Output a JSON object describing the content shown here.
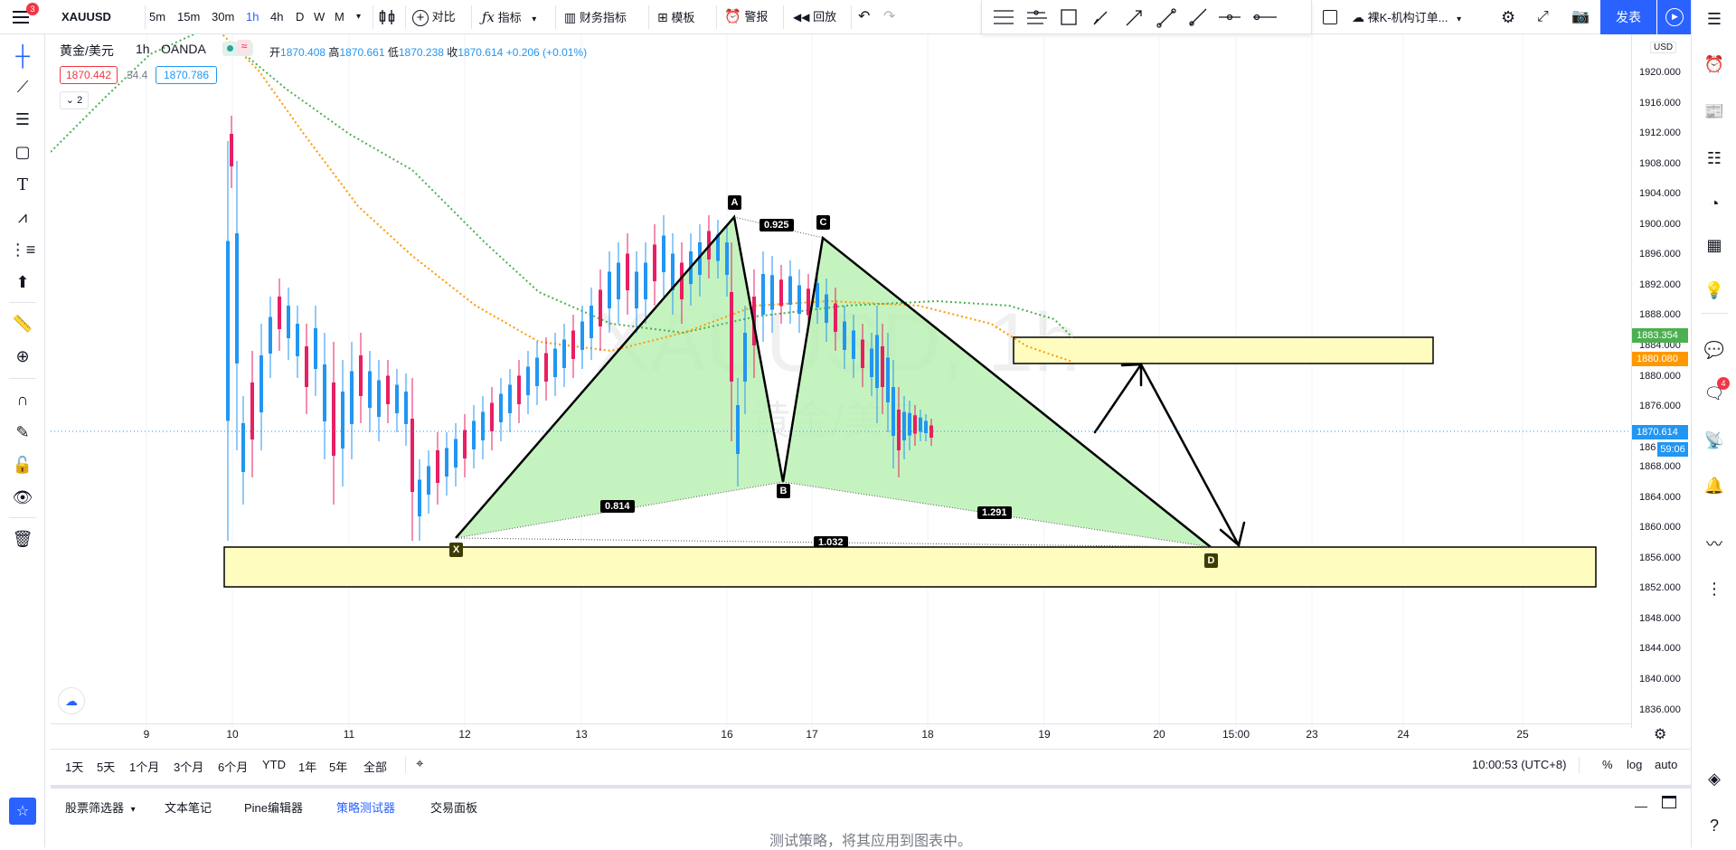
{
  "toolbar": {
    "symbol": "XAUUSD",
    "intervals": [
      "5m",
      "15m",
      "30m",
      "1h",
      "4h",
      "D",
      "W",
      "M"
    ],
    "compare": "对比",
    "indicators": "指标",
    "financials": "财务指标",
    "templates": "模板",
    "alerts": "警报",
    "replay": "回放",
    "layout_name": "裸K-机构订单...",
    "publish": "发表",
    "menu_badge": "3"
  },
  "legend": {
    "title": "黄金/美元",
    "interval": "1h",
    "source": "OANDA",
    "open_label": "开",
    "open": "1870.408",
    "high_label": "高",
    "high": "1870.661",
    "low_label": "低",
    "low": "1870.238",
    "close_label": "收",
    "close": "1870.614",
    "change": "+0.206 (+0.01%)",
    "bid": "1870.442",
    "spread": "34.4",
    "ask": "1870.786",
    "collapsed_count": "2"
  },
  "watermark": {
    "symbol": "XAUUSD, 1h",
    "name": "黄金/美元"
  },
  "price_axis": {
    "currency": "USD",
    "ticks": [
      "1920.000",
      "1916.000",
      "1912.000",
      "1908.000",
      "1904.000",
      "1900.000",
      "1896.000",
      "1892.000",
      "1888.000",
      "1884.000",
      "1880.000",
      "1876.000",
      "1872.000",
      "1868.000",
      "1864.000",
      "1860.000",
      "1856.000",
      "1852.000",
      "1848.000",
      "1844.000",
      "1840.000",
      "1836.000"
    ],
    "tag_green": "1883.354",
    "tag_orange": "1880.080",
    "tag_last": "1870.614",
    "tag_countdown": "59:06",
    "tag_last_partial": "186"
  },
  "time_axis": {
    "ticks": [
      "9",
      "10",
      "11",
      "12",
      "13",
      "16",
      "17",
      "18",
      "19",
      "20",
      "15:00",
      "23",
      "24",
      "25"
    ]
  },
  "pattern": {
    "points": [
      "X",
      "A",
      "B",
      "C",
      "D"
    ],
    "ratios": [
      "0.925",
      "0.814",
      "1.291",
      "1.032"
    ]
  },
  "ranges": [
    "1天",
    "5天",
    "1个月",
    "3个月",
    "6个月",
    "YTD",
    "1年",
    "5年",
    "全部"
  ],
  "clock": "10:00:53 (UTC+8)",
  "scale_options": [
    "%",
    "log",
    "auto"
  ],
  "bottom_tabs": [
    "股票筛选器",
    "文本笔记",
    "Pine编辑器",
    "策略测试器",
    "交易面板"
  ],
  "active_tab": "策略测试器",
  "strategy_hint": "测试策略，将其应用到图表中。",
  "notification_badge": "4",
  "colors": {
    "bull": "#2196f3",
    "bear": "#e91e63",
    "pattern_fill": "#b7f0b0",
    "zone_fill": "#fffcc0",
    "ma_green": "#4caf50",
    "ma_orange": "#ff9800",
    "accent": "#2962ff"
  }
}
